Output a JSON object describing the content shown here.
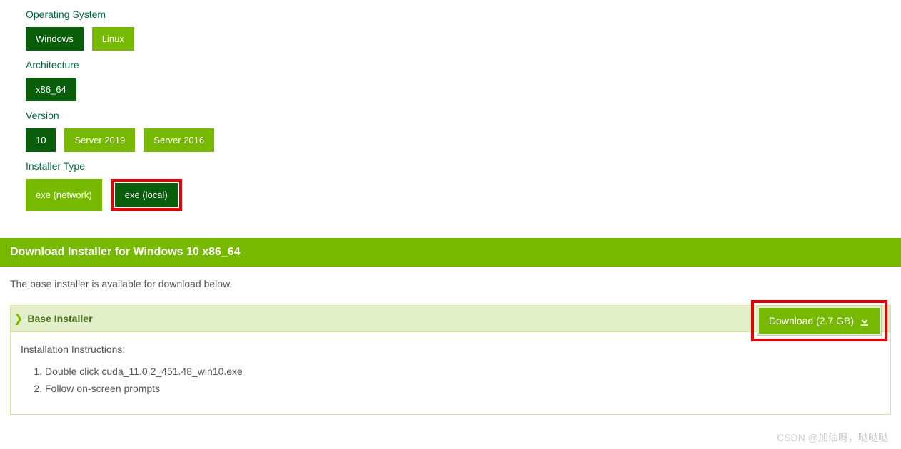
{
  "os": {
    "label": "Operating System",
    "selected": "Windows",
    "option": "Linux"
  },
  "arch": {
    "label": "Architecture",
    "selected": "x86_64"
  },
  "version": {
    "label": "Version",
    "selected": "10",
    "option1": "Server 2019",
    "option2": "Server 2016"
  },
  "installer": {
    "label": "Installer Type",
    "option": "exe (network)",
    "selected": "exe (local)"
  },
  "download": {
    "header": "Download Installer for Windows 10 x86_64",
    "intro": "The base installer is available for download below.",
    "base_title": "Base Installer",
    "button": "Download (2.7 GB)",
    "instr_title": "Installation Instructions:",
    "step1": "Double click cuda_11.0.2_451.48_win10.exe",
    "step2": "Follow on-screen prompts"
  },
  "watermark": "CSDN @加油呀，哒哒哒"
}
